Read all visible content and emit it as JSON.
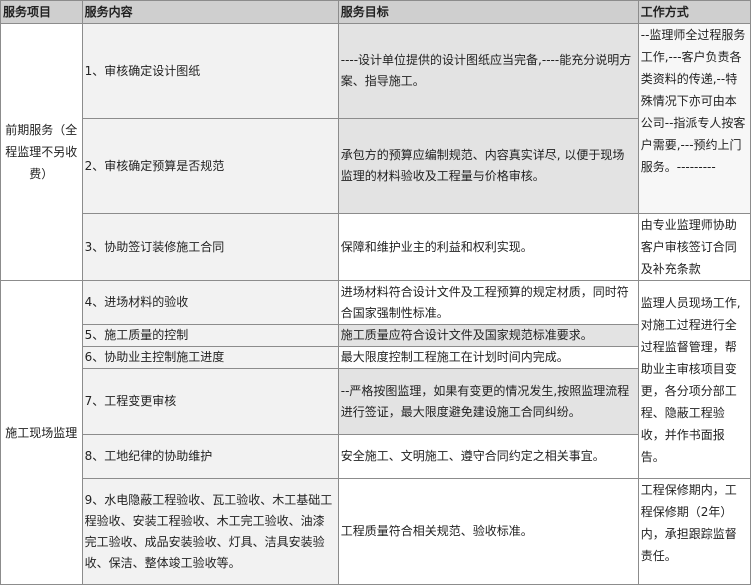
{
  "headers": {
    "project": "服务项目",
    "content": "服务内容",
    "goal": "服务目标",
    "method": "工作方式"
  },
  "group1": {
    "project": "前期服务（全程监理不另收费）",
    "rows": [
      {
        "content": "1、审核确定设计图纸",
        "goal": "----设计单位提供的设计图纸应当完备,----能充分说明方案、指导施工。"
      },
      {
        "content": "2、审核确定预算是否规范",
        "goal": "承包方的预算应编制规范、内容真实详尽, 以便于现场监理的材料验收及工程量与价格审核。"
      },
      {
        "content": "3、协助签订装修施工合同",
        "goal": "保障和维护业主的利益和权利实现。"
      }
    ],
    "method_a": "--监理师全过程服务工作,---客户负责各类资料的传递,--特殊情况下亦可由本公司--指派专人按客户需要,---预约上门服务。---------",
    "method_b": "由专业监理师协助客户审核签订合同及补充条款"
  },
  "group2": {
    "project": "施工现场监理",
    "rows": [
      {
        "content": "4、进场材料的验收",
        "goal": "进场材料符合设计文件及工程预算的规定材质，同时符合国家强制性标准。"
      },
      {
        "content": "5、施工质量的控制",
        "goal": "施工质量应符合设计文件及国家规范标准要求。"
      },
      {
        "content": "6、协助业主控制施工进度",
        "goal": "最大限度控制工程施工在计划时间内完成。"
      },
      {
        "content": "7、工程变更审核",
        "goal": "--严格按图监理，如果有变更的情况发生,按照监理流程进行签证，最大限度避免建设施工合同纠纷。"
      },
      {
        "content": "8、工地纪律的协助维护",
        "goal": "安全施工、文明施工、遵守合同约定之相关事宜。"
      },
      {
        "content": "9、水电隐蔽工程验收、瓦工验收、木工基础工程验收、安装工程验收、木工完工验收、油漆完工验收、成品安装验收、灯具、洁具安装验收、保洁、整体竣工验收等。",
        "goal": "工程质量符合相关规范、验收标准。"
      }
    ],
    "method_a": "监理人员现场工作,对施工过程进行全过程监督管理，帮助业主审核项目变更，各分项分部工程、隐蔽工程验收，并作书面报告。",
    "method_b": "工程保修期内，工程保修期（2年）内，承担跟踪监督责任。"
  }
}
